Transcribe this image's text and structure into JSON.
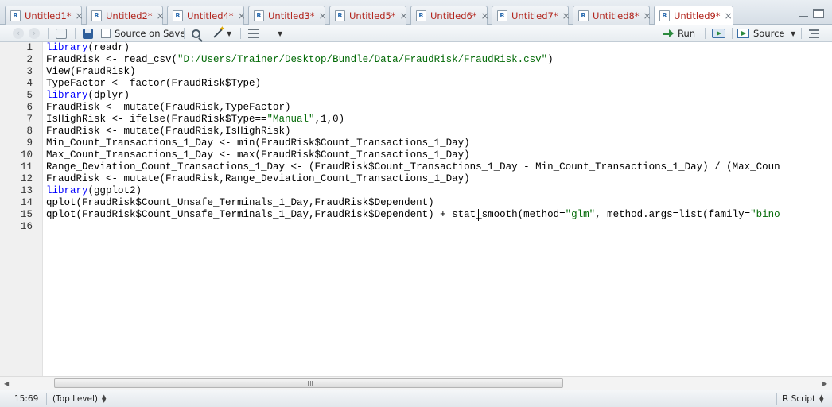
{
  "tabs": [
    {
      "label": "Untitled1*",
      "active": false
    },
    {
      "label": "Untitled2*",
      "active": false
    },
    {
      "label": "Untitled4*",
      "active": false
    },
    {
      "label": "Untitled3*",
      "active": false
    },
    {
      "label": "Untitled5*",
      "active": false
    },
    {
      "label": "Untitled6*",
      "active": false
    },
    {
      "label": "Untitled7*",
      "active": false
    },
    {
      "label": "Untitled8*",
      "active": false
    },
    {
      "label": "Untitled9*",
      "active": true
    }
  ],
  "tab_close_glyph": "×",
  "toolbar": {
    "source_on_save_label": "Source on Save",
    "source_on_save_checked": false,
    "run_label": "Run",
    "source_label": "Source"
  },
  "editor": {
    "line_numbers": [
      "1",
      "2",
      "3",
      "4",
      "5",
      "6",
      "7",
      "8",
      "9",
      "10",
      "11",
      "12",
      "13",
      "14",
      "15",
      "16"
    ],
    "lines": [
      [
        {
          "t": "library",
          "c": "kw"
        },
        {
          "t": "(readr)"
        }
      ],
      [
        {
          "t": "FraudRisk <- read_csv("
        },
        {
          "t": "\"D:/Users/Trainer/Desktop/Bundle/Data/FraudRisk/FraudRisk.csv\"",
          "c": "str"
        },
        {
          "t": ")"
        }
      ],
      [
        {
          "t": "View(FraudRisk)"
        }
      ],
      [
        {
          "t": "TypeFactor <- factor(FraudRisk$Type)"
        }
      ],
      [
        {
          "t": "library",
          "c": "kw"
        },
        {
          "t": "(dplyr)"
        }
      ],
      [
        {
          "t": "FraudRisk <- mutate(FraudRisk,TypeFactor)"
        }
      ],
      [
        {
          "t": "IsHighRisk <- ifelse(FraudRisk$Type=="
        },
        {
          "t": "\"Manual\"",
          "c": "str"
        },
        {
          "t": ",1,0)"
        }
      ],
      [
        {
          "t": "FraudRisk <- mutate(FraudRisk,IsHighRisk)"
        }
      ],
      [
        {
          "t": "Min_Count_Transactions_1_Day <- min(FraudRisk$Count_Transactions_1_Day)"
        }
      ],
      [
        {
          "t": "Max_Count_Transactions_1_Day <- max(FraudRisk$Count_Transactions_1_Day)"
        }
      ],
      [
        {
          "t": "Range_Deviation_Count_Transactions_1_Day <- (FraudRisk$Count_Transactions_1_Day - Min_Count_Transactions_1_Day) / (Max_Coun"
        }
      ],
      [
        {
          "t": "FraudRisk <- mutate(FraudRisk,Range_Deviation_Count_Transactions_1_Day)"
        }
      ],
      [
        {
          "t": "library",
          "c": "kw"
        },
        {
          "t": "(ggplot2)"
        }
      ],
      [
        {
          "t": "qplot(FraudRisk$Count_Unsafe_Terminals_1_Day,FraudRisk$Dependent)"
        }
      ],
      [
        {
          "t": "qplot(FraudRisk$Count_Unsafe_Terminals_1_Day,FraudRisk$Dependent) + stat_smooth(method="
        },
        {
          "t": "\"glm\"",
          "c": "str"
        },
        {
          "t": ", method.args=list(family="
        },
        {
          "t": "\"bino",
          "c": "str"
        }
      ],
      []
    ]
  },
  "status": {
    "cursor_position": "15:69",
    "scope": "(Top Level)",
    "file_type": "R Script"
  },
  "colors": {
    "keyword": "#0000ff",
    "string": "#036a07",
    "tab_text": "#b3261e"
  }
}
